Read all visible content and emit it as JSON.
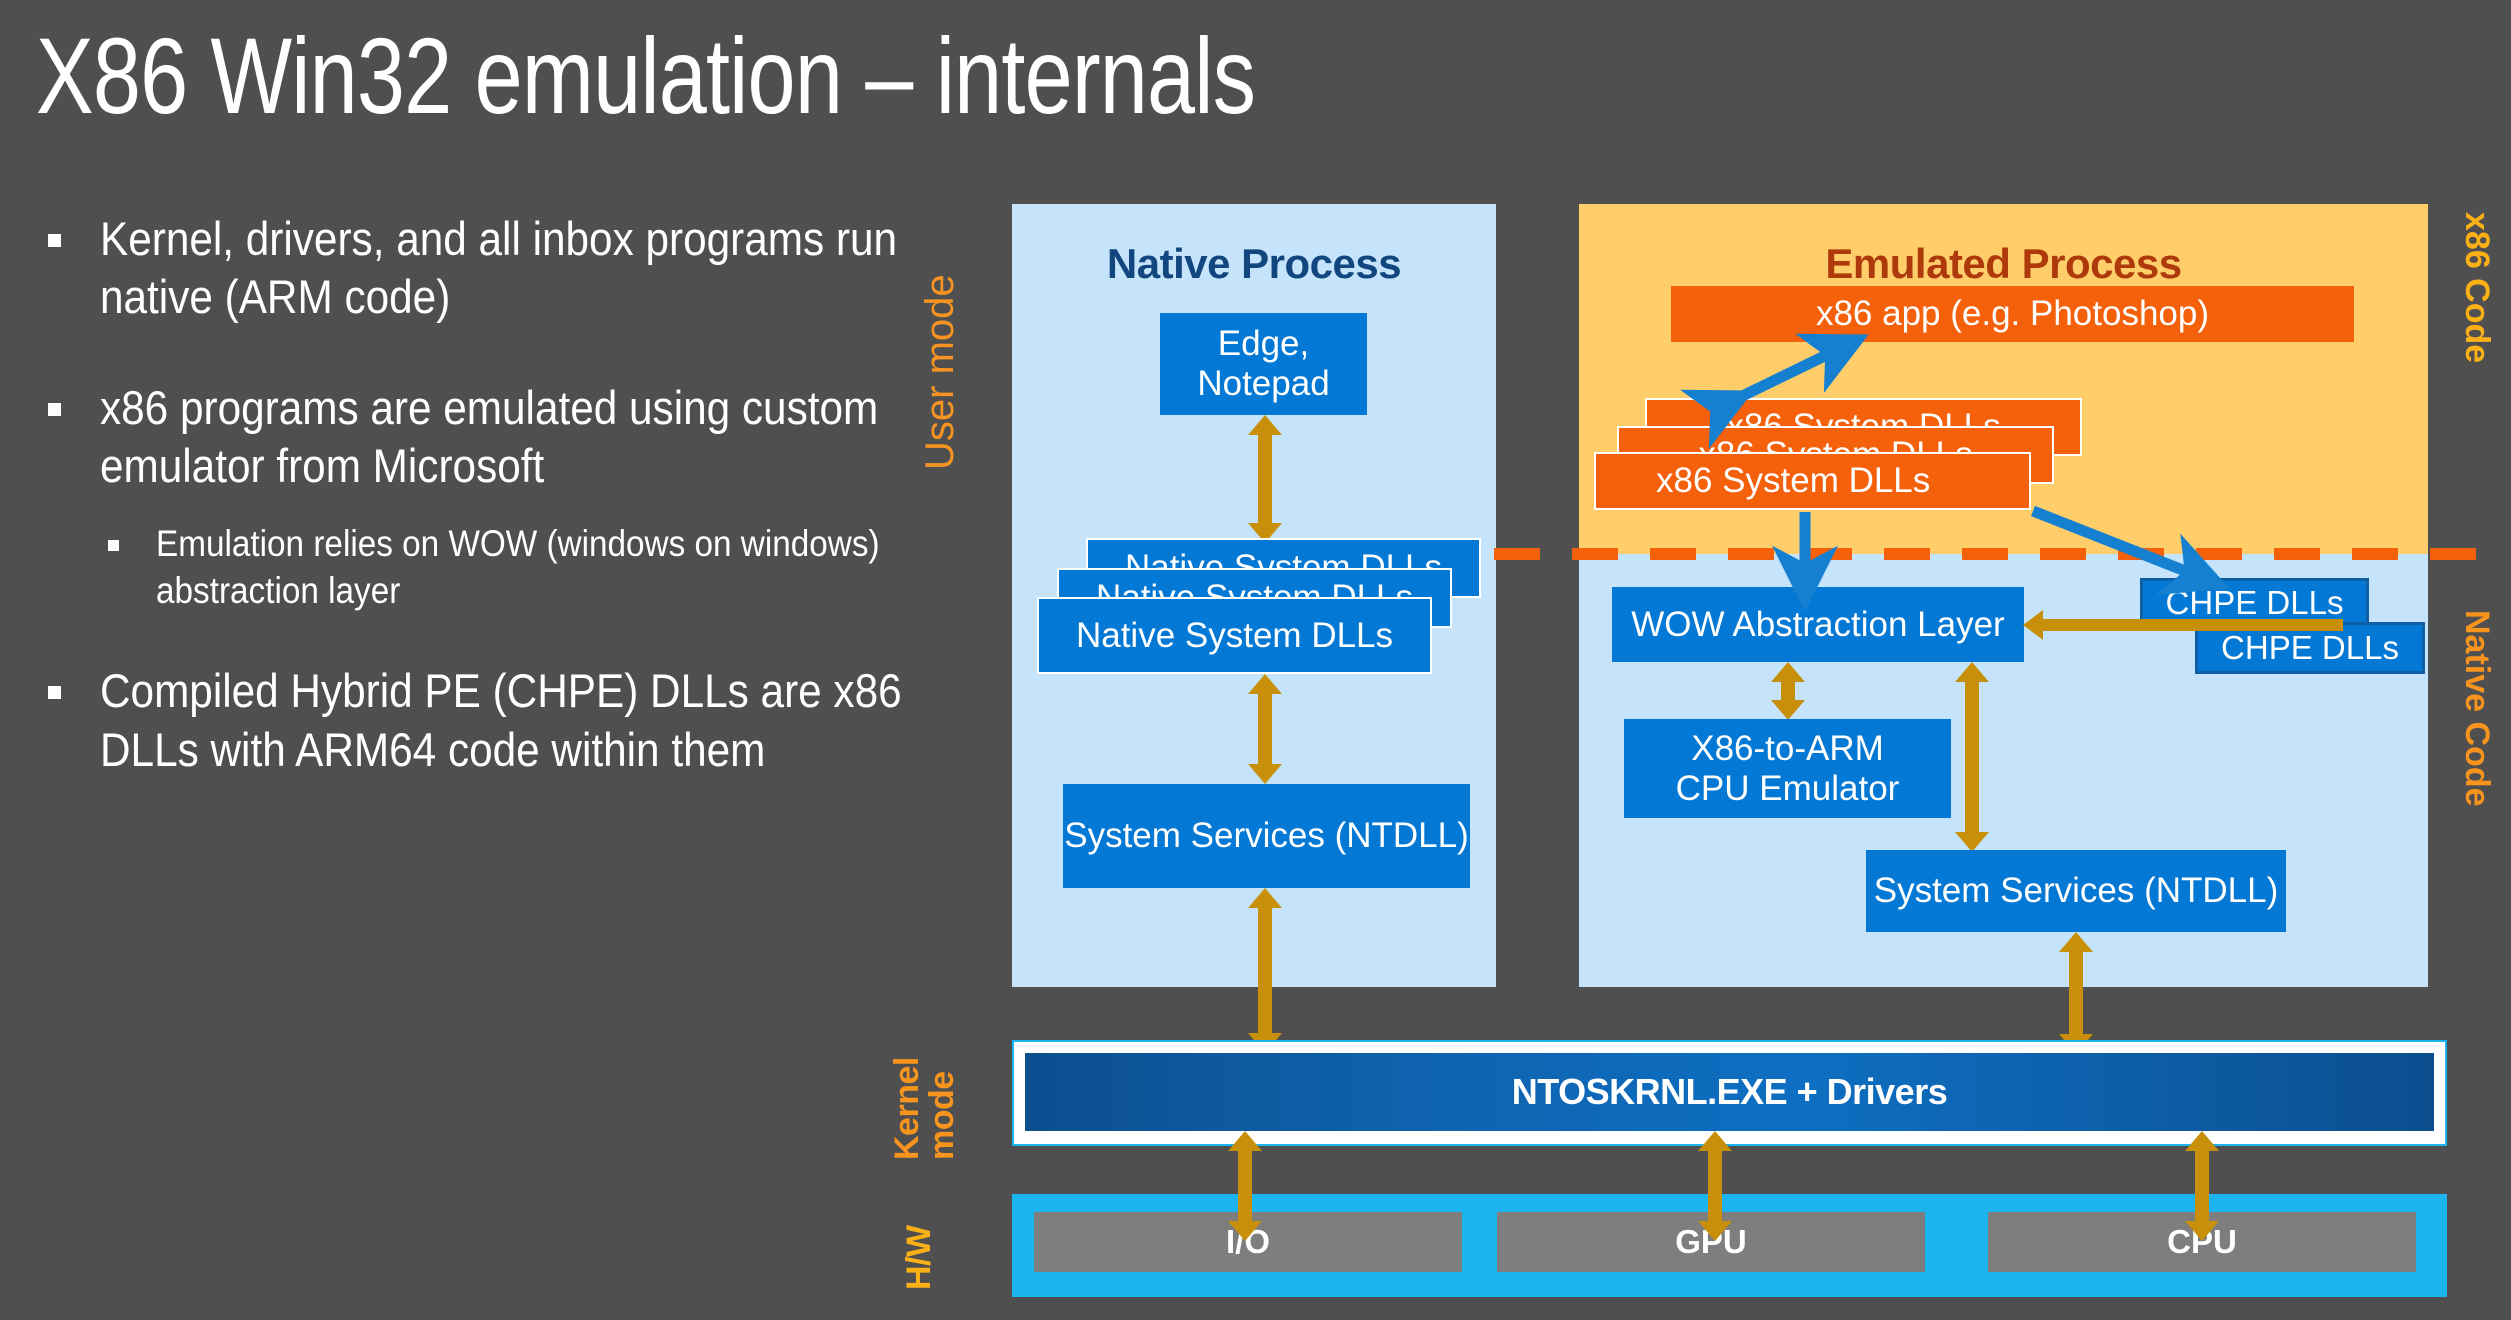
{
  "slide": {
    "title": "X86 Win32 emulation – internals"
  },
  "bullets": [
    {
      "level": 1,
      "text": "Kernel, drivers, and all inbox programs run native (ARM code)"
    },
    {
      "level": 1,
      "text": "x86 programs are emulated using custom emulator from Microsoft"
    },
    {
      "level": 2,
      "text": "Emulation relies on WOW (windows on windows) abstraction layer"
    },
    {
      "level": 1,
      "text": "Compiled Hybrid PE (CHPE) DLLs are x86 DLLs with ARM64 code within them"
    }
  ],
  "side_labels": {
    "user_mode": "User mode",
    "kernel_mode_line1": "Kernel",
    "kernel_mode_line2": "mode",
    "hw": "H/W",
    "x86_code": "x86 Code",
    "native_code": "Native Code"
  },
  "native_process": {
    "title": "Native Process",
    "app_box_line1": "Edge,",
    "app_box_line2": "Notepad",
    "dll_stack": [
      "Native System DLLs",
      "Native System DLLs",
      "Native System DLLs"
    ],
    "ntdll": "System Services (NTDLL)"
  },
  "emulated_process": {
    "title": "Emulated Process",
    "app_box": "x86 app (e.g. Photoshop)",
    "dll_stack": [
      "x86 System DLLs",
      "x86 System DLLs",
      "x86 System DLLs"
    ],
    "wow_layer": "WOW Abstraction Layer",
    "cpu_emulator_line1": "X86-to-ARM",
    "cpu_emulator_line2": "CPU Emulator",
    "ntdll": "System Services (NTDLL)",
    "chpe_boxes": [
      "CHPE DLLs",
      "CHPE DLLs"
    ]
  },
  "kernel": {
    "label": "NTOSKRNL.EXE + Drivers"
  },
  "hardware": {
    "boxes": [
      "I/O",
      "GPU",
      "CPU"
    ]
  },
  "colors": {
    "background": "#4f4f4f",
    "native_panel": "#C5E4FB",
    "emulated_panel": "#FFCE6B",
    "native_box": "#0378D4",
    "emulated_box": "#F4610A",
    "gold_arrow": "#C8900A",
    "blue_arrow": "#1680D0",
    "accent_orange": "#F7941E",
    "accent_amber": "#FBB116",
    "kernel_blue": "#0C4E8E",
    "hw_cyan": "#1BB4EE",
    "hw_box_gray": "#7E7E7E",
    "native_title_text": "#11477E",
    "emulated_title_text": "#AE3A0C"
  }
}
